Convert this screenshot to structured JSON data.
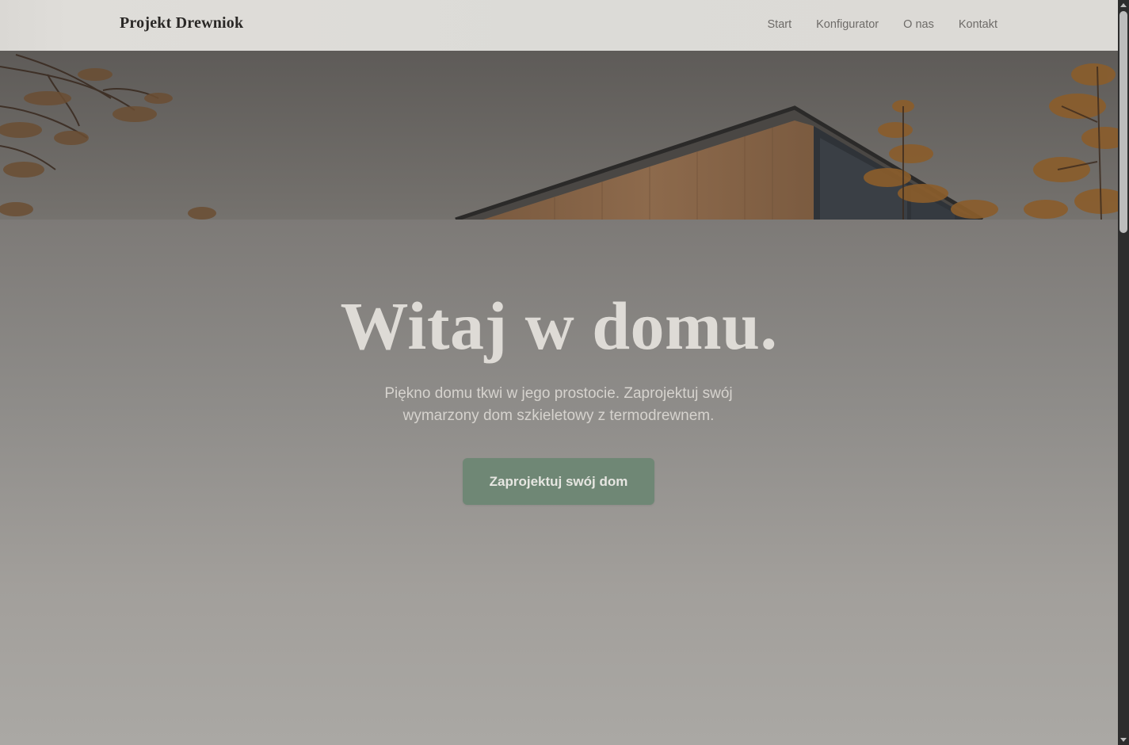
{
  "header": {
    "logo": "Projekt Drewniok",
    "nav": [
      {
        "label": "Start"
      },
      {
        "label": "Konfigurator"
      },
      {
        "label": "O nas"
      },
      {
        "label": "Kontakt"
      }
    ]
  },
  "hero": {
    "headline": "Witaj w domu.",
    "subtitle": "Piękno domu tkwi w jego prostocie. Zaprojektuj swój wymarzony dom szkieletowy z termodrewnem.",
    "cta_label": "Zaprojektuj swój dom"
  },
  "colors": {
    "cta_background": "#6f8775",
    "header_background": "#dcdbd7",
    "headline_text": "#dedbd6"
  }
}
